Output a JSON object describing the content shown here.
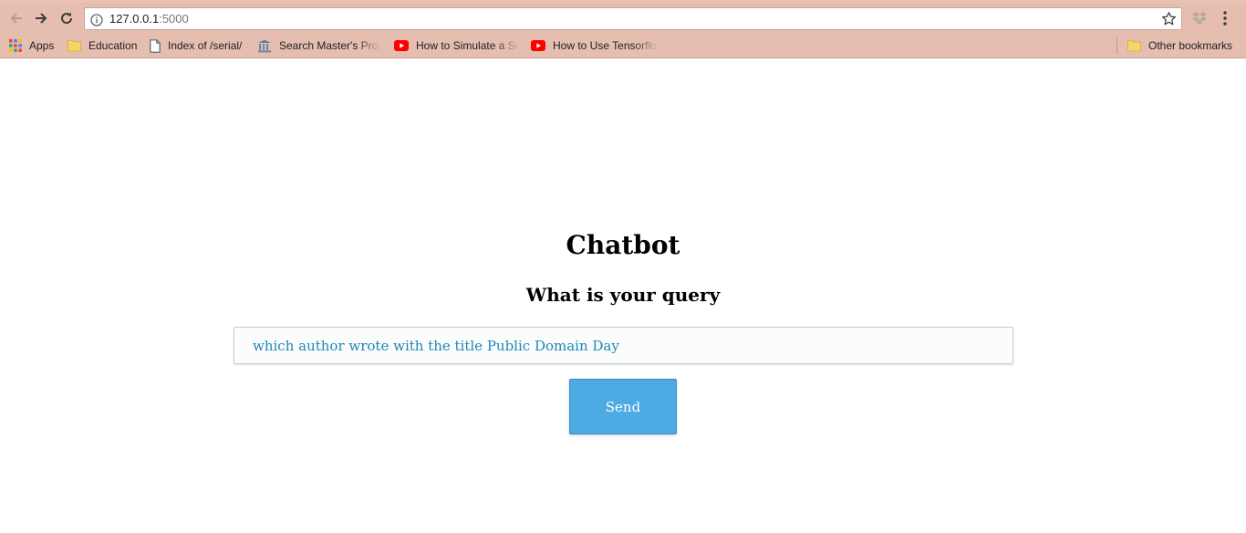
{
  "browser": {
    "url_host": "127.0.0.1",
    "url_port": ":5000",
    "bookmarks": [
      {
        "label": "Apps",
        "icon": "apps-grid-icon"
      },
      {
        "label": "Education",
        "icon": "folder-icon"
      },
      {
        "label": "Index of /serial/",
        "icon": "page-icon"
      },
      {
        "label": "Search Master's Prog",
        "icon": "institution-icon"
      },
      {
        "label": "How to Simulate a Se",
        "icon": "youtube-icon"
      },
      {
        "label": "How to Use Tensorflo",
        "icon": "youtube-icon"
      }
    ],
    "other_bookmarks": {
      "label": "Other bookmarks",
      "icon": "folder-icon"
    }
  },
  "page": {
    "title": "Chatbot",
    "subtitle": "What is your query",
    "query_value": "which author wrote with the title Public Domain Day",
    "send_label": "Send"
  },
  "colors": {
    "chrome": "#e6beb0",
    "send_button": "#4eaae2",
    "input_text": "#1e87b8"
  }
}
